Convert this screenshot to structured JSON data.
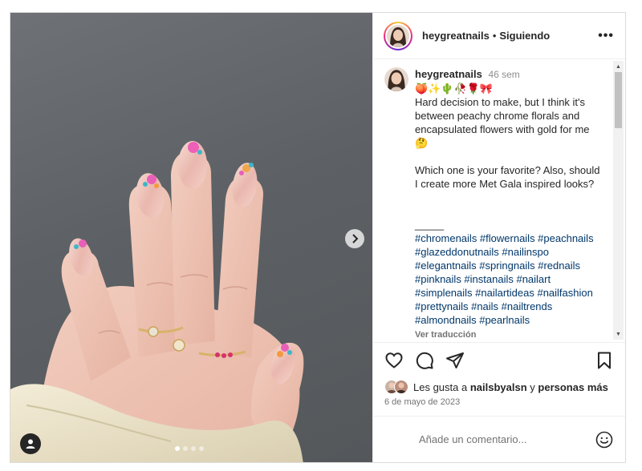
{
  "post": {
    "author": "heygreatnails",
    "follow_status": "Siguiendo",
    "separator": "•",
    "more_label": "•••"
  },
  "caption": {
    "username": "heygreatnails",
    "time": "46 sem",
    "emojis": "🍑✨🌵🥀🌹🎀",
    "text": "Hard decision to make, but I think it's between peachy chrome florals and encapsulated flowers with gold for me 🤔\n\nWhich one is your favorite? Also, should I create more Met Gala inspired looks?\n\n\n_____",
    "hashtags": "#chromenails #flowernails #peachnails #glazeddonutnails #nailinspo #elegantnails #springnails #rednails #pinknails #instanails #nailart #simplenails #nailartideas #nailfashion #prettynails #nails #nailtrends #almondnails #pearlnails",
    "translate": "Ver traducción"
  },
  "likes": {
    "prefix": "Les gusta a",
    "user": "nailsbyalsn",
    "conj": "y",
    "others": "personas más"
  },
  "date": "6 de mayo de 2023",
  "comment_input": {
    "placeholder": "Añade un comentario..."
  },
  "media": {
    "total_slides": 4,
    "active_slide": 1
  },
  "icons": {
    "like": "heart-icon",
    "comment": "comment-icon",
    "share": "send-icon",
    "save": "bookmark-icon",
    "emoji": "emoji-icon",
    "next": "chevron-right-icon",
    "tag": "user-tag-icon"
  },
  "colors": {
    "link": "#00376b",
    "muted": "#737373",
    "text": "#262626"
  }
}
